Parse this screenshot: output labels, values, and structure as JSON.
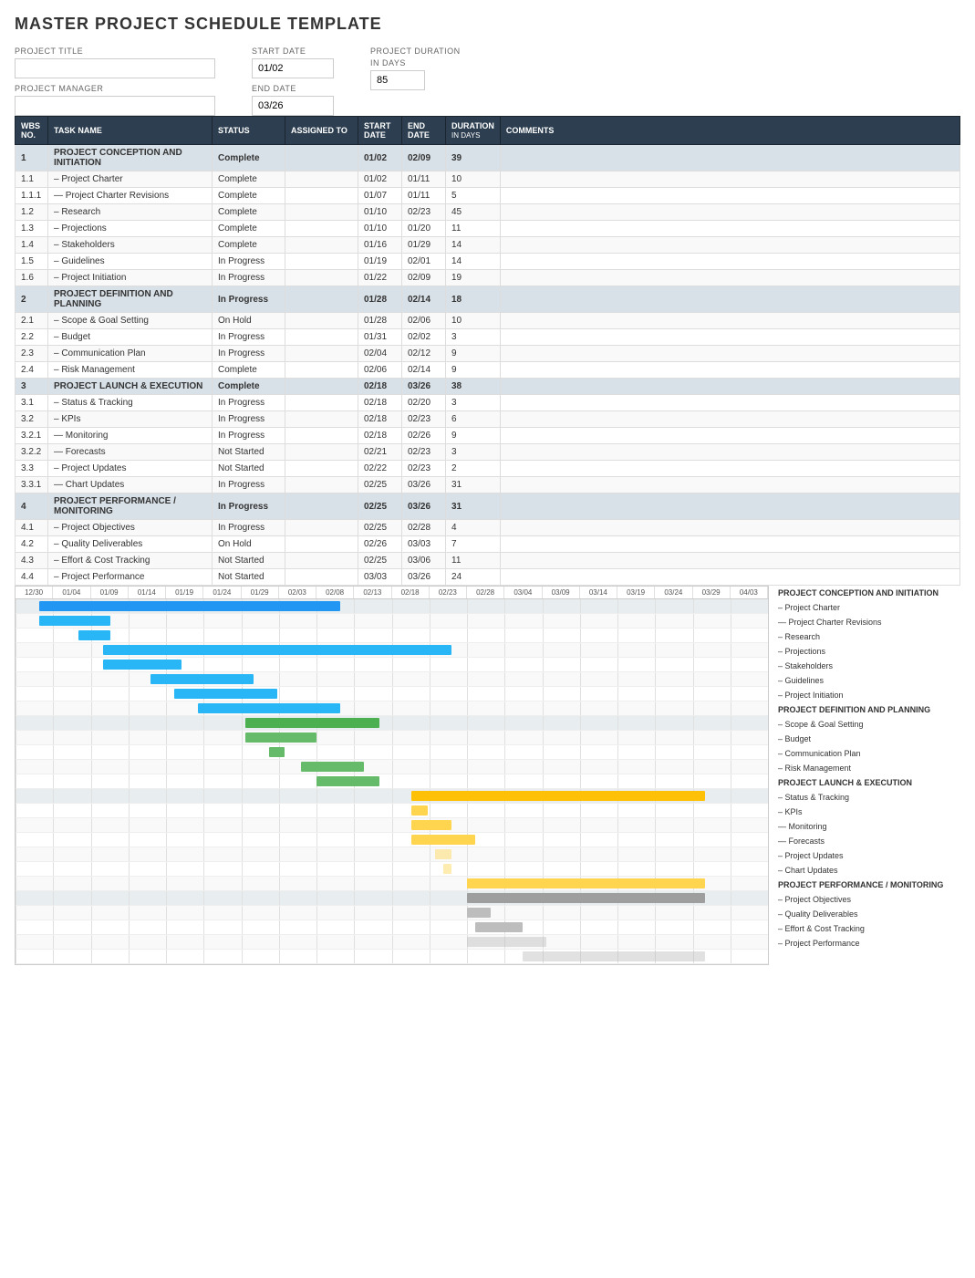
{
  "title": "MASTER PROJECT SCHEDULE TEMPLATE",
  "form": {
    "project_title_label": "PROJECT TITLE",
    "project_manager_label": "PROJECT MANAGER",
    "start_date_label": "START DATE",
    "start_date_value": "01/02",
    "end_date_label": "END DATE",
    "end_date_value": "03/26",
    "duration_label": "PROJECT DURATION",
    "duration_sub": "in days",
    "duration_value": "85"
  },
  "table": {
    "headers": {
      "wbs": "WBS NO.",
      "task": "TASK NAME",
      "status": "STATUS",
      "assigned": "ASSIGNED TO",
      "start": "START DATE",
      "end": "END DATE",
      "duration": "DURATION",
      "duration_sub": "in days",
      "comments": "COMMENTS"
    },
    "rows": [
      {
        "wbs": "1",
        "task": "PROJECT CONCEPTION AND INITIATION",
        "status": "Complete",
        "assigned": "",
        "start": "01/02",
        "end": "02/09",
        "duration": "39",
        "indent": 0,
        "section": true
      },
      {
        "wbs": "1.1",
        "task": "– Project Charter",
        "status": "Complete",
        "assigned": "",
        "start": "01/02",
        "end": "01/11",
        "duration": "10",
        "indent": 1,
        "section": false
      },
      {
        "wbs": "1.1.1",
        "task": "— Project Charter Revisions",
        "status": "Complete",
        "assigned": "",
        "start": "01/07",
        "end": "01/11",
        "duration": "5",
        "indent": 2,
        "section": false
      },
      {
        "wbs": "1.2",
        "task": "– Research",
        "status": "Complete",
        "assigned": "",
        "start": "01/10",
        "end": "02/23",
        "duration": "45",
        "indent": 1,
        "section": false
      },
      {
        "wbs": "1.3",
        "task": "– Projections",
        "status": "Complete",
        "assigned": "",
        "start": "01/10",
        "end": "01/20",
        "duration": "11",
        "indent": 1,
        "section": false
      },
      {
        "wbs": "1.4",
        "task": "– Stakeholders",
        "status": "Complete",
        "assigned": "",
        "start": "01/16",
        "end": "01/29",
        "duration": "14",
        "indent": 1,
        "section": false
      },
      {
        "wbs": "1.5",
        "task": "– Guidelines",
        "status": "In Progress",
        "assigned": "",
        "start": "01/19",
        "end": "02/01",
        "duration": "14",
        "indent": 1,
        "section": false
      },
      {
        "wbs": "1.6",
        "task": "– Project Initiation",
        "status": "In Progress",
        "assigned": "",
        "start": "01/22",
        "end": "02/09",
        "duration": "19",
        "indent": 1,
        "section": false
      },
      {
        "wbs": "2",
        "task": "PROJECT DEFINITION AND PLANNING",
        "status": "In Progress",
        "assigned": "",
        "start": "01/28",
        "end": "02/14",
        "duration": "18",
        "indent": 0,
        "section": true
      },
      {
        "wbs": "2.1",
        "task": "– Scope & Goal Setting",
        "status": "On Hold",
        "assigned": "",
        "start": "01/28",
        "end": "02/06",
        "duration": "10",
        "indent": 1,
        "section": false
      },
      {
        "wbs": "2.2",
        "task": "– Budget",
        "status": "In Progress",
        "assigned": "",
        "start": "01/31",
        "end": "02/02",
        "duration": "3",
        "indent": 1,
        "section": false
      },
      {
        "wbs": "2.3",
        "task": "– Communication Plan",
        "status": "In Progress",
        "assigned": "",
        "start": "02/04",
        "end": "02/12",
        "duration": "9",
        "indent": 1,
        "section": false
      },
      {
        "wbs": "2.4",
        "task": "– Risk Management",
        "status": "Complete",
        "assigned": "",
        "start": "02/06",
        "end": "02/14",
        "duration": "9",
        "indent": 1,
        "section": false
      },
      {
        "wbs": "3",
        "task": "PROJECT LAUNCH & EXECUTION",
        "status": "Complete",
        "assigned": "",
        "start": "02/18",
        "end": "03/26",
        "duration": "38",
        "indent": 0,
        "section": true
      },
      {
        "wbs": "3.1",
        "task": "– Status & Tracking",
        "status": "In Progress",
        "assigned": "",
        "start": "02/18",
        "end": "02/20",
        "duration": "3",
        "indent": 1,
        "section": false
      },
      {
        "wbs": "3.2",
        "task": "– KPIs",
        "status": "In Progress",
        "assigned": "",
        "start": "02/18",
        "end": "02/23",
        "duration": "6",
        "indent": 1,
        "section": false
      },
      {
        "wbs": "3.2.1",
        "task": "— Monitoring",
        "status": "In Progress",
        "assigned": "",
        "start": "02/18",
        "end": "02/26",
        "duration": "9",
        "indent": 2,
        "section": false
      },
      {
        "wbs": "3.2.2",
        "task": "— Forecasts",
        "status": "Not Started",
        "assigned": "",
        "start": "02/21",
        "end": "02/23",
        "duration": "3",
        "indent": 2,
        "section": false
      },
      {
        "wbs": "3.3",
        "task": "– Project Updates",
        "status": "Not Started",
        "assigned": "",
        "start": "02/22",
        "end": "02/23",
        "duration": "2",
        "indent": 1,
        "section": false
      },
      {
        "wbs": "3.3.1",
        "task": "— Chart Updates",
        "status": "In Progress",
        "assigned": "",
        "start": "02/25",
        "end": "03/26",
        "duration": "31",
        "indent": 2,
        "section": false
      },
      {
        "wbs": "4",
        "task": "PROJECT PERFORMANCE / MONITORING",
        "status": "In Progress",
        "assigned": "",
        "start": "02/25",
        "end": "03/26",
        "duration": "31",
        "indent": 0,
        "section": true
      },
      {
        "wbs": "4.1",
        "task": "– Project Objectives",
        "status": "In Progress",
        "assigned": "",
        "start": "02/25",
        "end": "02/28",
        "duration": "4",
        "indent": 1,
        "section": false
      },
      {
        "wbs": "4.2",
        "task": "– Quality Deliverables",
        "status": "On Hold",
        "assigned": "",
        "start": "02/26",
        "end": "03/03",
        "duration": "7",
        "indent": 1,
        "section": false
      },
      {
        "wbs": "4.3",
        "task": "– Effort & Cost Tracking",
        "status": "Not Started",
        "assigned": "",
        "start": "02/25",
        "end": "03/06",
        "duration": "11",
        "indent": 1,
        "section": false
      },
      {
        "wbs": "4.4",
        "task": "– Project Performance",
        "status": "Not Started",
        "assigned": "",
        "start": "03/03",
        "end": "03/26",
        "duration": "24",
        "indent": 1,
        "section": false
      }
    ]
  },
  "gantt": {
    "date_labels": [
      "12/30",
      "01/04",
      "01/09",
      "01/14",
      "01/19",
      "01/24",
      "01/29",
      "02/03",
      "02/08",
      "02/13",
      "02/18",
      "02/23",
      "02/28",
      "03/04",
      "03/09",
      "03/14",
      "03/19",
      "03/24",
      "03/29",
      "04/03"
    ],
    "legend": [
      {
        "label": "PROJECT CONCEPTION AND INITIATION",
        "bold": true
      },
      {
        "label": "– Project Charter",
        "bold": false
      },
      {
        "label": "— Project Charter Revisions",
        "bold": false
      },
      {
        "label": "– Research",
        "bold": false
      },
      {
        "label": "– Projections",
        "bold": false
      },
      {
        "label": "– Stakeholders",
        "bold": false
      },
      {
        "label": "– Guidelines",
        "bold": false
      },
      {
        "label": "– Project Initiation",
        "bold": false
      },
      {
        "label": "PROJECT DEFINITION AND PLANNING",
        "bold": true
      },
      {
        "label": "– Scope & Goal Setting",
        "bold": false
      },
      {
        "label": "– Budget",
        "bold": false
      },
      {
        "label": "– Communication Plan",
        "bold": false
      },
      {
        "label": "– Risk Management",
        "bold": false
      },
      {
        "label": "PROJECT LAUNCH & EXECUTION",
        "bold": true
      },
      {
        "label": "– Status & Tracking",
        "bold": false
      },
      {
        "label": "– KPIs",
        "bold": false
      },
      {
        "label": "— Monitoring",
        "bold": false
      },
      {
        "label": "— Forecasts",
        "bold": false
      },
      {
        "label": "– Project Updates",
        "bold": false
      },
      {
        "label": "– Chart Updates",
        "bold": false
      },
      {
        "label": "PROJECT PERFORMANCE / MONITORING",
        "bold": true
      },
      {
        "label": "– Project Objectives",
        "bold": false
      },
      {
        "label": "– Quality Deliverables",
        "bold": false
      },
      {
        "label": "– Effort & Cost Tracking",
        "bold": false
      },
      {
        "label": "– Project Performance",
        "bold": false
      }
    ]
  }
}
